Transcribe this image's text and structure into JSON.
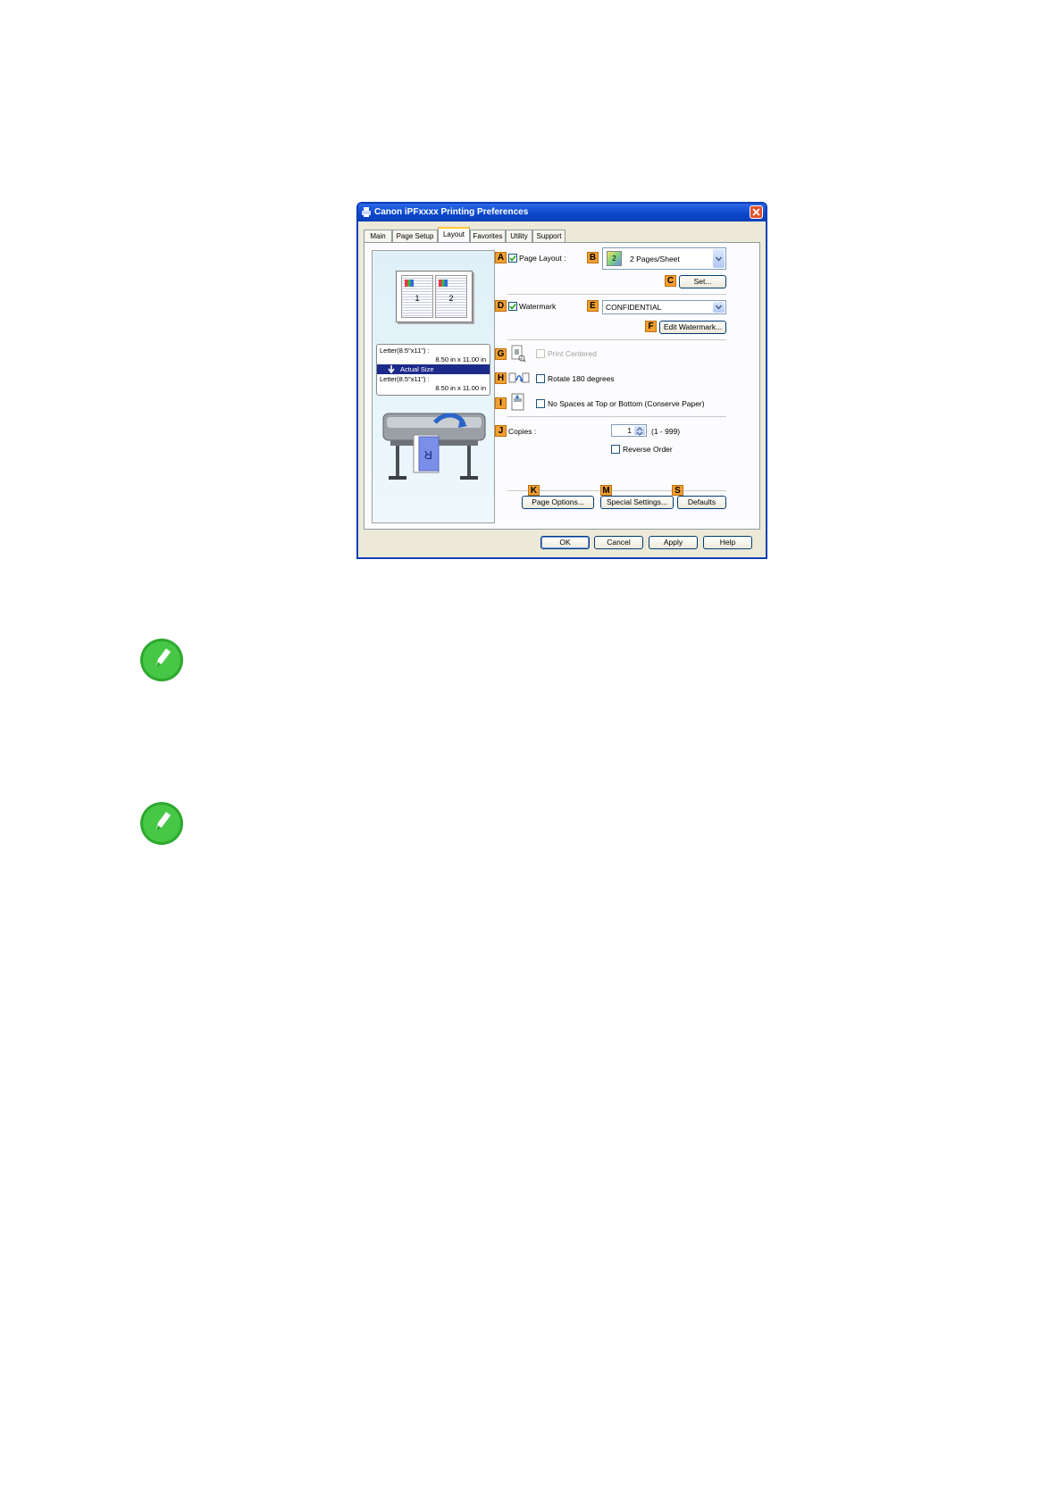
{
  "window": {
    "title": "Canon iPFxxxx Printing Preferences",
    "tabs": [
      {
        "label": "Main"
      },
      {
        "label": "Page Setup"
      },
      {
        "label": "Layout"
      },
      {
        "label": "Favorites"
      },
      {
        "label": "Utility"
      },
      {
        "label": "Support"
      }
    ],
    "active_tab": "Layout"
  },
  "preview": {
    "page_numbers": [
      "1",
      "2"
    ],
    "paper_line1": "Letter(8.5\"x11\") :",
    "paper_line2": "8.50 in x 11.00 in",
    "mode": "Actual Size",
    "output_line1": "Letter(8.5\"x11\") :",
    "output_line2": "8.50 in x 11.00 in",
    "printer_sheet_letter": "R"
  },
  "layout": {
    "page_layout": {
      "marker": "A",
      "label": "Page Layout :",
      "checked": true
    },
    "pages_per_sheet": {
      "marker": "B",
      "value": "2 Pages/Sheet",
      "icon_text": "2"
    },
    "set_button": {
      "marker": "C",
      "label": "Set..."
    },
    "watermark": {
      "marker": "D",
      "label": "Watermark",
      "checked": true
    },
    "watermark_select": {
      "marker": "E",
      "value": "CONFIDENTIAL"
    },
    "edit_watermark": {
      "marker": "F",
      "label": "Edit Watermark..."
    },
    "print_centered": {
      "marker": "G",
      "label": "Print Centered",
      "checked": false,
      "enabled": false
    },
    "rotate": {
      "marker": "H",
      "label": "Rotate 180 degrees",
      "checked": false
    },
    "no_spaces": {
      "marker": "I",
      "label": "No Spaces at Top or Bottom (Conserve Paper)",
      "checked": false
    },
    "copies": {
      "marker": "J",
      "label": "Copies :",
      "value": "1",
      "range": "(1 - 999)"
    },
    "reverse_order": {
      "label": "Reverse Order",
      "checked": false
    },
    "page_options": {
      "marker": "K",
      "label": "Page Options..."
    },
    "special_settings": {
      "marker": "M",
      "label": "Special Settings..."
    },
    "defaults": {
      "marker": "S",
      "label": "Defaults"
    }
  },
  "footer": {
    "ok": "OK",
    "cancel": "Cancel",
    "apply": "Apply",
    "help": "Help"
  },
  "colors": {
    "titlebar": "#0b46c8",
    "marker": "#f0a030",
    "note_icon": "#3ec43e",
    "selection": "#1c2a8a"
  }
}
